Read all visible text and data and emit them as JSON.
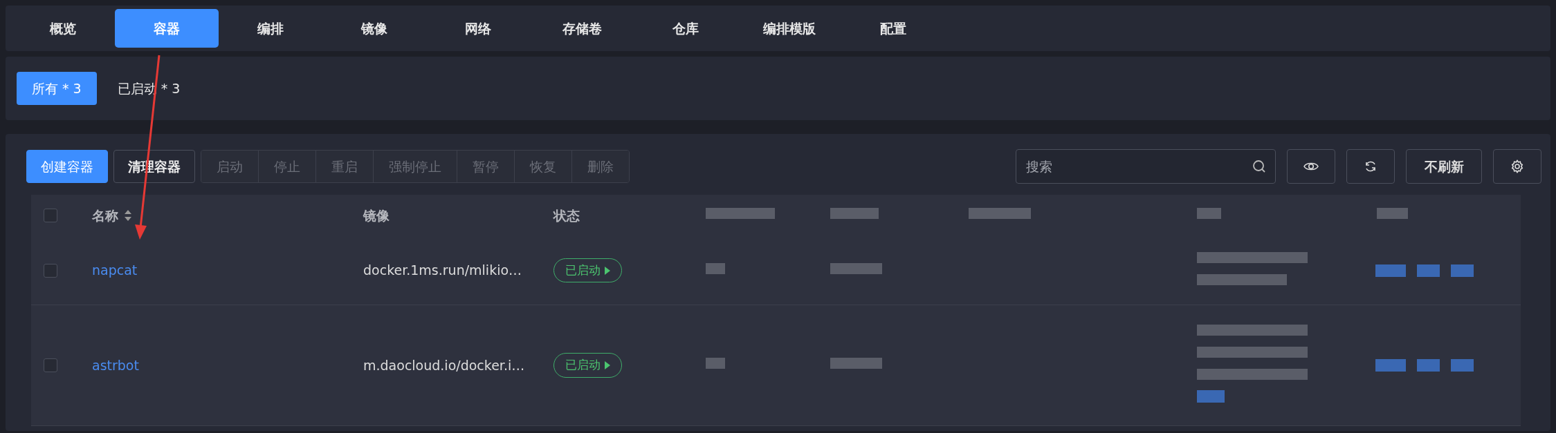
{
  "nav_tabs": [
    {
      "label": "概览",
      "selected": false
    },
    {
      "label": "容器",
      "selected": true
    },
    {
      "label": "编排",
      "selected": false
    },
    {
      "label": "镜像",
      "selected": false
    },
    {
      "label": "网络",
      "selected": false
    },
    {
      "label": "存储卷",
      "selected": false
    },
    {
      "label": "仓库",
      "selected": false
    },
    {
      "label": "编排模版",
      "selected": false
    },
    {
      "label": "配置",
      "selected": false
    }
  ],
  "filters": [
    {
      "label": "所有 * 3",
      "selected": true
    },
    {
      "label": "已启动 * 3",
      "selected": false
    }
  ],
  "toolbar": {
    "buttons": [
      {
        "label": "创建容器",
        "kind": "primary"
      },
      {
        "label": "清理容器",
        "kind": "outline"
      }
    ],
    "group": [
      {
        "label": "启动",
        "disabled": true
      },
      {
        "label": "停止",
        "disabled": true
      },
      {
        "label": "重启",
        "disabled": true
      },
      {
        "label": "强制停止",
        "disabled": true
      },
      {
        "label": "暂停",
        "disabled": true
      },
      {
        "label": "恢复",
        "disabled": true
      },
      {
        "label": "删除",
        "disabled": true
      }
    ],
    "search": {
      "placeholder": "搜索"
    },
    "refresh_button": "不刷新"
  },
  "table": {
    "select_all_checked": false,
    "columns": [
      "名称",
      "镜像",
      "状态"
    ],
    "rows": [
      {
        "name": "napcat",
        "image": "docker.1ms.run/mlikio…",
        "status": "已启动",
        "checked": false
      },
      {
        "name": "astrbot",
        "image": "m.daocloud.io/docker.i…",
        "status": "已启动",
        "checked": false
      }
    ]
  }
}
